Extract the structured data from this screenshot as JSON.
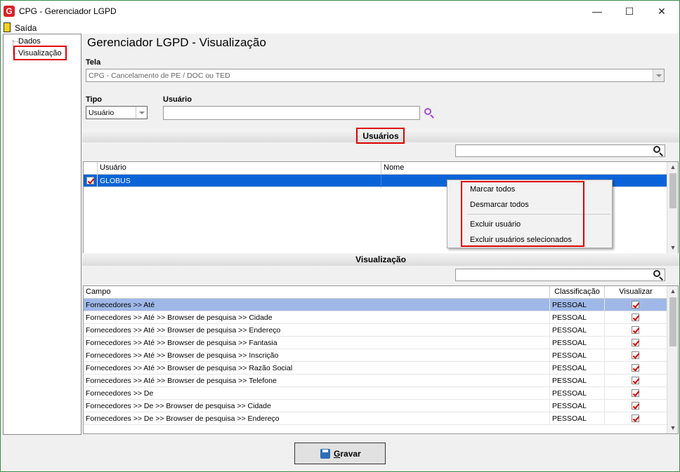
{
  "window": {
    "app_icon": "G",
    "title": "CPG - Gerenciador LGPD",
    "minimize": "—",
    "maximize": "☐",
    "close": "✕"
  },
  "menu": {
    "exit_label": "Saída"
  },
  "sidebar": {
    "items": [
      {
        "label": "Dados"
      },
      {
        "label": "Visualização"
      }
    ]
  },
  "page": {
    "title": "Gerenciador LGPD - Visualização"
  },
  "form": {
    "tela_label": "Tela",
    "tela_value": "CPG - Cancelamento de PE / DOC ou TED",
    "tipo_label": "Tipo",
    "tipo_value": "Usuário",
    "usuario_label": "Usuário",
    "usuario_value": ""
  },
  "usuarios_section": {
    "title": "Usuários",
    "search_value": "",
    "columns": [
      "Usuário",
      "Nome"
    ],
    "rows": [
      {
        "checked": true,
        "usuario": "GLOBUS",
        "nome": ""
      }
    ]
  },
  "context_menu": {
    "items": [
      "Marcar todos",
      "Desmarcar todos",
      "Excluir usuário",
      "Excluir usuários selecionados"
    ]
  },
  "visualizacao_section": {
    "title": "Visualização",
    "search_value": "",
    "columns": [
      "Campo",
      "Classificação",
      "Visualizar"
    ],
    "rows": [
      {
        "campo": "Fornecedores >> Até",
        "classificacao": "PESSOAL",
        "visualizar": true
      },
      {
        "campo": "Fornecedores >> Até >> Browser de pesquisa >> Cidade",
        "classificacao": "PESSOAL",
        "visualizar": true
      },
      {
        "campo": "Fornecedores >> Até >> Browser de pesquisa >> Endereço",
        "classificacao": "PESSOAL",
        "visualizar": true
      },
      {
        "campo": "Fornecedores >> Até >> Browser de pesquisa >> Fantasia",
        "classificacao": "PESSOAL",
        "visualizar": true
      },
      {
        "campo": "Fornecedores >> Até >> Browser de pesquisa >> Inscrição",
        "classificacao": "PESSOAL",
        "visualizar": true
      },
      {
        "campo": "Fornecedores >> Até >> Browser de pesquisa >> Razão Social",
        "classificacao": "PESSOAL",
        "visualizar": true
      },
      {
        "campo": "Fornecedores >> Até >> Browser de pesquisa >> Telefone",
        "classificacao": "PESSOAL",
        "visualizar": true
      },
      {
        "campo": "Fornecedores >> De",
        "classificacao": "PESSOAL",
        "visualizar": true
      },
      {
        "campo": "Fornecedores >> De >> Browser de pesquisa >> Cidade",
        "classificacao": "PESSOAL",
        "visualizar": true
      },
      {
        "campo": "Fornecedores >> De >> Browser de pesquisa >> Endereço",
        "classificacao": "PESSOAL",
        "visualizar": true
      }
    ]
  },
  "actions": {
    "save_first_letter": "G",
    "save_rest": "ravar"
  },
  "colors": {
    "selection_blue": "#0a64d8",
    "selection_light": "#9fb8e8",
    "highlight_red": "#e00000",
    "window_border": "#3c8b4a"
  }
}
